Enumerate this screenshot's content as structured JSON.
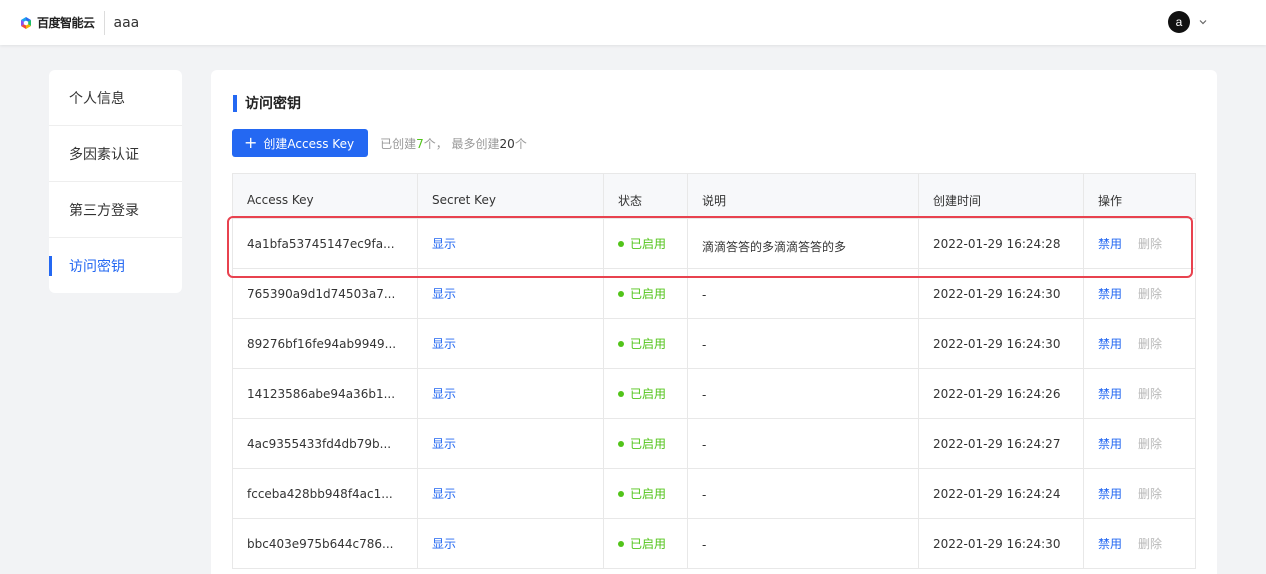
{
  "header": {
    "logo_text": "百度智能云",
    "project_name": "aaa",
    "avatar_letter": "a"
  },
  "sidebar": {
    "items": [
      {
        "label": "个人信息"
      },
      {
        "label": "多因素认证"
      },
      {
        "label": "第三方登录"
      },
      {
        "label": "访问密钥"
      }
    ],
    "active_index": 3
  },
  "main": {
    "title": "访问密钥",
    "create_button": "创建Access Key",
    "quota": {
      "prefix": "已创建",
      "created": "7",
      "mid": "个，  最多创建",
      "max": "20",
      "suffix": "个"
    }
  },
  "table": {
    "columns": [
      "Access Key",
      "Secret Key",
      "状态",
      "说明",
      "创建时间",
      "操作"
    ],
    "rows": [
      {
        "access_key": "4a1bfa53745147ec9fa...",
        "secret": "显示",
        "status": "已启用",
        "desc": "滴滴答答的多滴滴答答的多",
        "created": "2022-01-29 16:24:28",
        "action_disable": "禁用",
        "action_delete": "删除"
      },
      {
        "access_key": "765390a9d1d74503a7...",
        "secret": "显示",
        "status": "已启用",
        "desc": "-",
        "created": "2022-01-29 16:24:30",
        "action_disable": "禁用",
        "action_delete": "删除"
      },
      {
        "access_key": "89276bf16fe94ab9949...",
        "secret": "显示",
        "status": "已启用",
        "desc": "-",
        "created": "2022-01-29 16:24:30",
        "action_disable": "禁用",
        "action_delete": "删除"
      },
      {
        "access_key": "14123586abe94a36b1...",
        "secret": "显示",
        "status": "已启用",
        "desc": "-",
        "created": "2022-01-29 16:24:26",
        "action_disable": "禁用",
        "action_delete": "删除"
      },
      {
        "access_key": "4ac9355433fd4db79b...",
        "secret": "显示",
        "status": "已启用",
        "desc": "-",
        "created": "2022-01-29 16:24:27",
        "action_disable": "禁用",
        "action_delete": "删除"
      },
      {
        "access_key": "fcceba428bb948f4ac1...",
        "secret": "显示",
        "status": "已启用",
        "desc": "-",
        "created": "2022-01-29 16:24:24",
        "action_disable": "禁用",
        "action_delete": "删除"
      },
      {
        "access_key": "bbc403e975b644c786...",
        "secret": "显示",
        "status": "已启用",
        "desc": "-",
        "created": "2022-01-29 16:24:30",
        "action_disable": "禁用",
        "action_delete": "删除"
      }
    ]
  },
  "colors": {
    "primary": "#2468f2",
    "status_green": "#52c41a",
    "highlight_red": "#e8424f"
  }
}
